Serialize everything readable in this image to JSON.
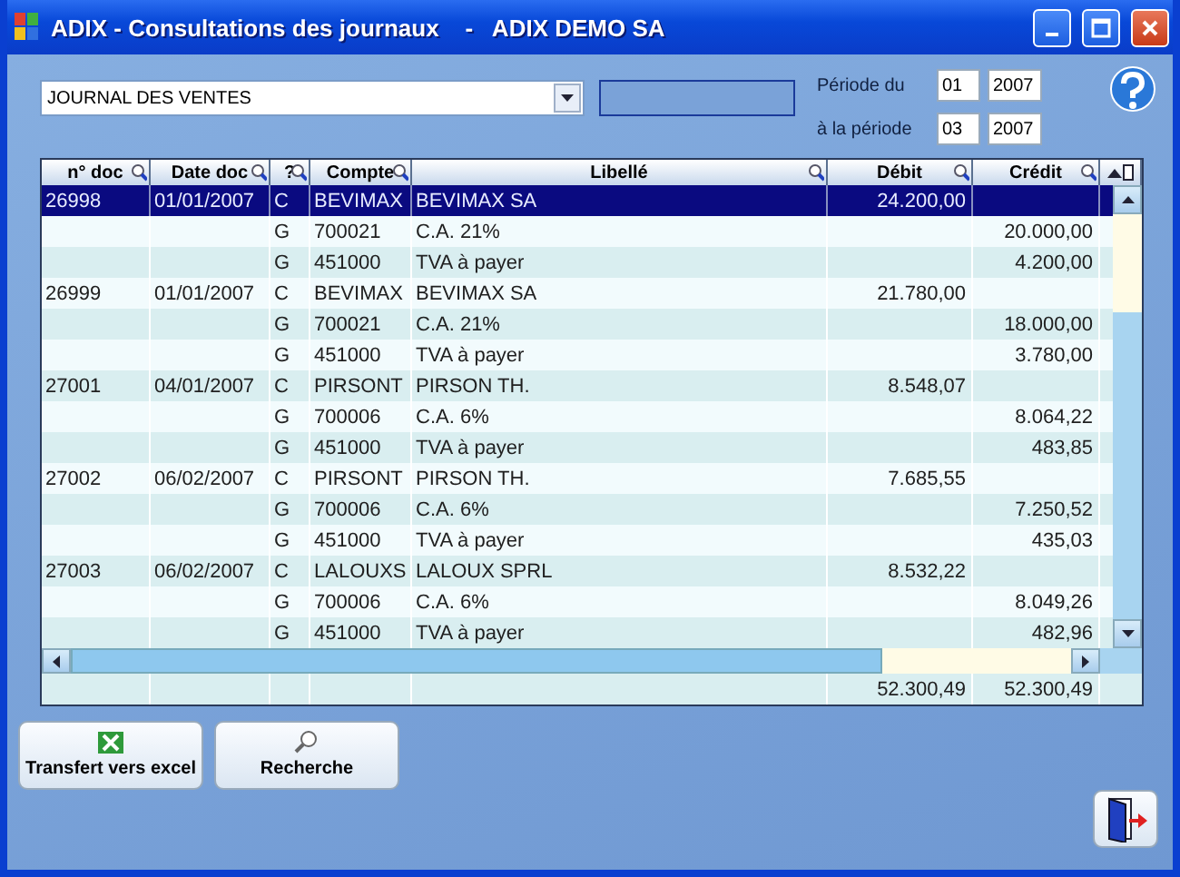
{
  "window": {
    "title": "ADIX - Consultations des journaux    -   ADIX DEMO SA"
  },
  "journal": {
    "value": "JOURNAL DES VENTES"
  },
  "period": {
    "from_label": "Période du",
    "from_month": "01",
    "from_year": "2007",
    "to_label": "à la période",
    "to_month": "03",
    "to_year": "2007"
  },
  "table": {
    "columns": [
      "n° doc",
      "Date doc",
      "?",
      "Compte",
      "Libellé",
      "Débit",
      "Crédit"
    ],
    "rows": [
      {
        "cells": [
          "26998",
          "01/01/2007",
          "C",
          "BEVIMAX",
          "BEVIMAX SA",
          "24.200,00",
          ""
        ],
        "selected": true
      },
      {
        "cells": [
          "",
          "",
          "G",
          "700021",
          "C.A. 21%",
          "",
          "20.000,00"
        ],
        "selected": false
      },
      {
        "cells": [
          "",
          "",
          "G",
          "451000",
          "TVA à payer",
          "",
          "4.200,00"
        ],
        "selected": false
      },
      {
        "cells": [
          "26999",
          "01/01/2007",
          "C",
          "BEVIMAX",
          "BEVIMAX SA",
          "21.780,00",
          ""
        ],
        "selected": false
      },
      {
        "cells": [
          "",
          "",
          "G",
          "700021",
          "C.A. 21%",
          "",
          "18.000,00"
        ],
        "selected": false
      },
      {
        "cells": [
          "",
          "",
          "G",
          "451000",
          "TVA à payer",
          "",
          "3.780,00"
        ],
        "selected": false
      },
      {
        "cells": [
          "27001",
          "04/01/2007",
          "C",
          "PIRSONT",
          "PIRSON TH.",
          "8.548,07",
          ""
        ],
        "selected": false
      },
      {
        "cells": [
          "",
          "",
          "G",
          "700006",
          "C.A. 6%",
          "",
          "8.064,22"
        ],
        "selected": false
      },
      {
        "cells": [
          "",
          "",
          "G",
          "451000",
          "TVA à payer",
          "",
          "483,85"
        ],
        "selected": false
      },
      {
        "cells": [
          "27002",
          "06/02/2007",
          "C",
          "PIRSONT",
          "PIRSON TH.",
          "7.685,55",
          ""
        ],
        "selected": false
      },
      {
        "cells": [
          "",
          "",
          "G",
          "700006",
          "C.A. 6%",
          "",
          "7.250,52"
        ],
        "selected": false
      },
      {
        "cells": [
          "",
          "",
          "G",
          "451000",
          "TVA à payer",
          "",
          "435,03"
        ],
        "selected": false
      },
      {
        "cells": [
          "27003",
          "06/02/2007",
          "C",
          "LALOUXS",
          "LALOUX SPRL",
          "8.532,22",
          ""
        ],
        "selected": false
      },
      {
        "cells": [
          "",
          "",
          "G",
          "700006",
          "C.A. 6%",
          "",
          "8.049,26"
        ],
        "selected": false
      },
      {
        "cells": [
          "",
          "",
          "G",
          "451000",
          "TVA à payer",
          "",
          "482,96"
        ],
        "selected": false
      }
    ],
    "totals": {
      "debit": "52.300,49",
      "credit": "52.300,49"
    }
  },
  "buttons": [
    {
      "kind": "excel",
      "label": "Transfert vers excel"
    },
    {
      "kind": "search",
      "label": "Recherche"
    }
  ]
}
